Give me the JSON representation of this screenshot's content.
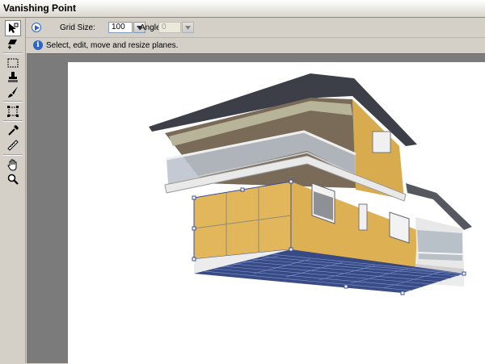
{
  "window": {
    "title": "Vanishing Point"
  },
  "toolbar": {
    "tools": [
      {
        "name": "edit-plane-tool",
        "icon": "edit-plane-icon",
        "active": true
      },
      {
        "name": "create-plane-tool",
        "icon": "create-plane-icon"
      },
      {
        "name": "marquee-tool",
        "icon": "marquee-icon"
      },
      {
        "name": "stamp-tool",
        "icon": "stamp-icon"
      },
      {
        "name": "brush-tool",
        "icon": "brush-icon"
      },
      {
        "name": "transform-tool",
        "icon": "transform-icon"
      },
      {
        "name": "eyedropper-tool",
        "icon": "eyedropper-icon"
      },
      {
        "name": "measure-tool",
        "icon": "measure-icon"
      },
      {
        "name": "hand-tool",
        "icon": "hand-icon"
      },
      {
        "name": "zoom-tool",
        "icon": "zoom-icon"
      }
    ]
  },
  "options": {
    "grid_size_label": "Grid Size:",
    "grid_size_value": "100",
    "angle_label": "Angle:",
    "angle_value": "0"
  },
  "info": {
    "text": "Select, edit, move and resize planes."
  },
  "colors": {
    "chrome": "#d4d0c8",
    "canvas_bg": "#7b7b7b",
    "accent": "#2f63c4",
    "plane_grid": "#3a4f9a",
    "wall": "#e5bb5e"
  }
}
